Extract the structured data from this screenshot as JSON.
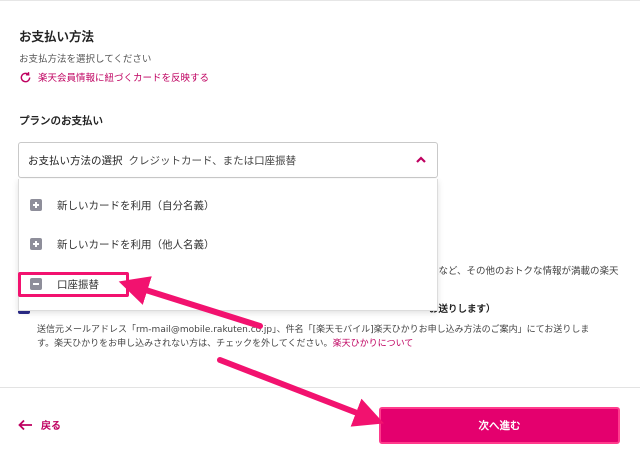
{
  "payment": {
    "title": "お支払い方法",
    "subtitle": "お支払方法を選択してください",
    "reflect_link": "楽天会員情報に紐づくカードを反映する"
  },
  "plan": {
    "title": "プランのお支払い",
    "select_label": "お支払い方法の選択",
    "select_value": "クレジットカード、または口座振替",
    "options": [
      {
        "label": "新しいカードを利用（自分名義）",
        "icon": "plus-square-icon"
      },
      {
        "label": "新しいカードを利用（他人名義）",
        "icon": "plus-square-icon"
      },
      {
        "label": "口座振替",
        "icon": "minus-square-icon"
      }
    ]
  },
  "background_text": {
    "line_right_partial": "様など、その他のおトクな情報が満載の楽天",
    "line_right_bold_partial": "お送りします）",
    "desc_line1": "送信元メールアドレス「rm-mail@mobile.rakuten.co.jp」、件名「[楽天モバイル]楽天ひかりお申し込み方法のご案内」にてお送りしま",
    "desc_line2_prefix": "す。楽天ひかりをお申し込みされない方は、チェックを外してください。",
    "desc_line2_link": "楽天ひかりについて"
  },
  "footer": {
    "back_label": "戻る",
    "next_label": "次へ進む"
  },
  "colors": {
    "brand": "#bf0060",
    "button": "#e4006e",
    "annotation": "#f2126f"
  }
}
